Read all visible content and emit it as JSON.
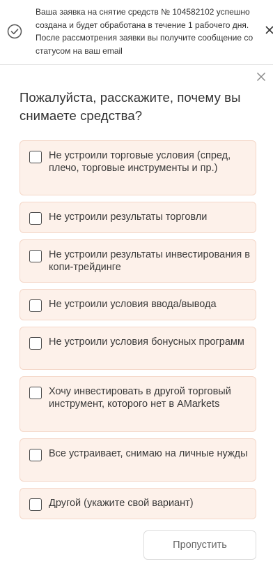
{
  "notification": {
    "icon": "check-circle-icon",
    "message": "Ваша заявка на снятие средств № 104582102 успешно создана и будет обработана в течение 1 рабочего дня. После рассмотрения заявки вы получите сообщение со статусом на ваш email",
    "close_icon": "close-icon"
  },
  "survey": {
    "close_icon": "close-icon",
    "title": "Пожалуйста, расскажите, почему вы снимаете средства?",
    "options": [
      {
        "label": "Не устроили торговые условия (спред, плечо, торговые инструменты и пр.)",
        "checked": false
      },
      {
        "label": "Не устроили результаты торговли",
        "checked": false
      },
      {
        "label": "Не устроили результаты инвестирования в копи-трейдинге",
        "checked": false
      },
      {
        "label": "Не устроили условия ввода/вывода",
        "checked": false
      },
      {
        "label": "Не устроили условия бонусных программ",
        "checked": false
      },
      {
        "label": "Хочу инвестировать в другой торговый инструмент, которого нет в AMarkets",
        "checked": false
      },
      {
        "label": "Все устраивает, снимаю на личные нужды",
        "checked": false
      },
      {
        "label": "Другой (укажите свой вариант)",
        "checked": false
      }
    ],
    "skip_label": "Пропустить"
  },
  "colors": {
    "option_background": "#fdf1ea",
    "option_border": "#f4d7c8",
    "text": "#333333"
  }
}
